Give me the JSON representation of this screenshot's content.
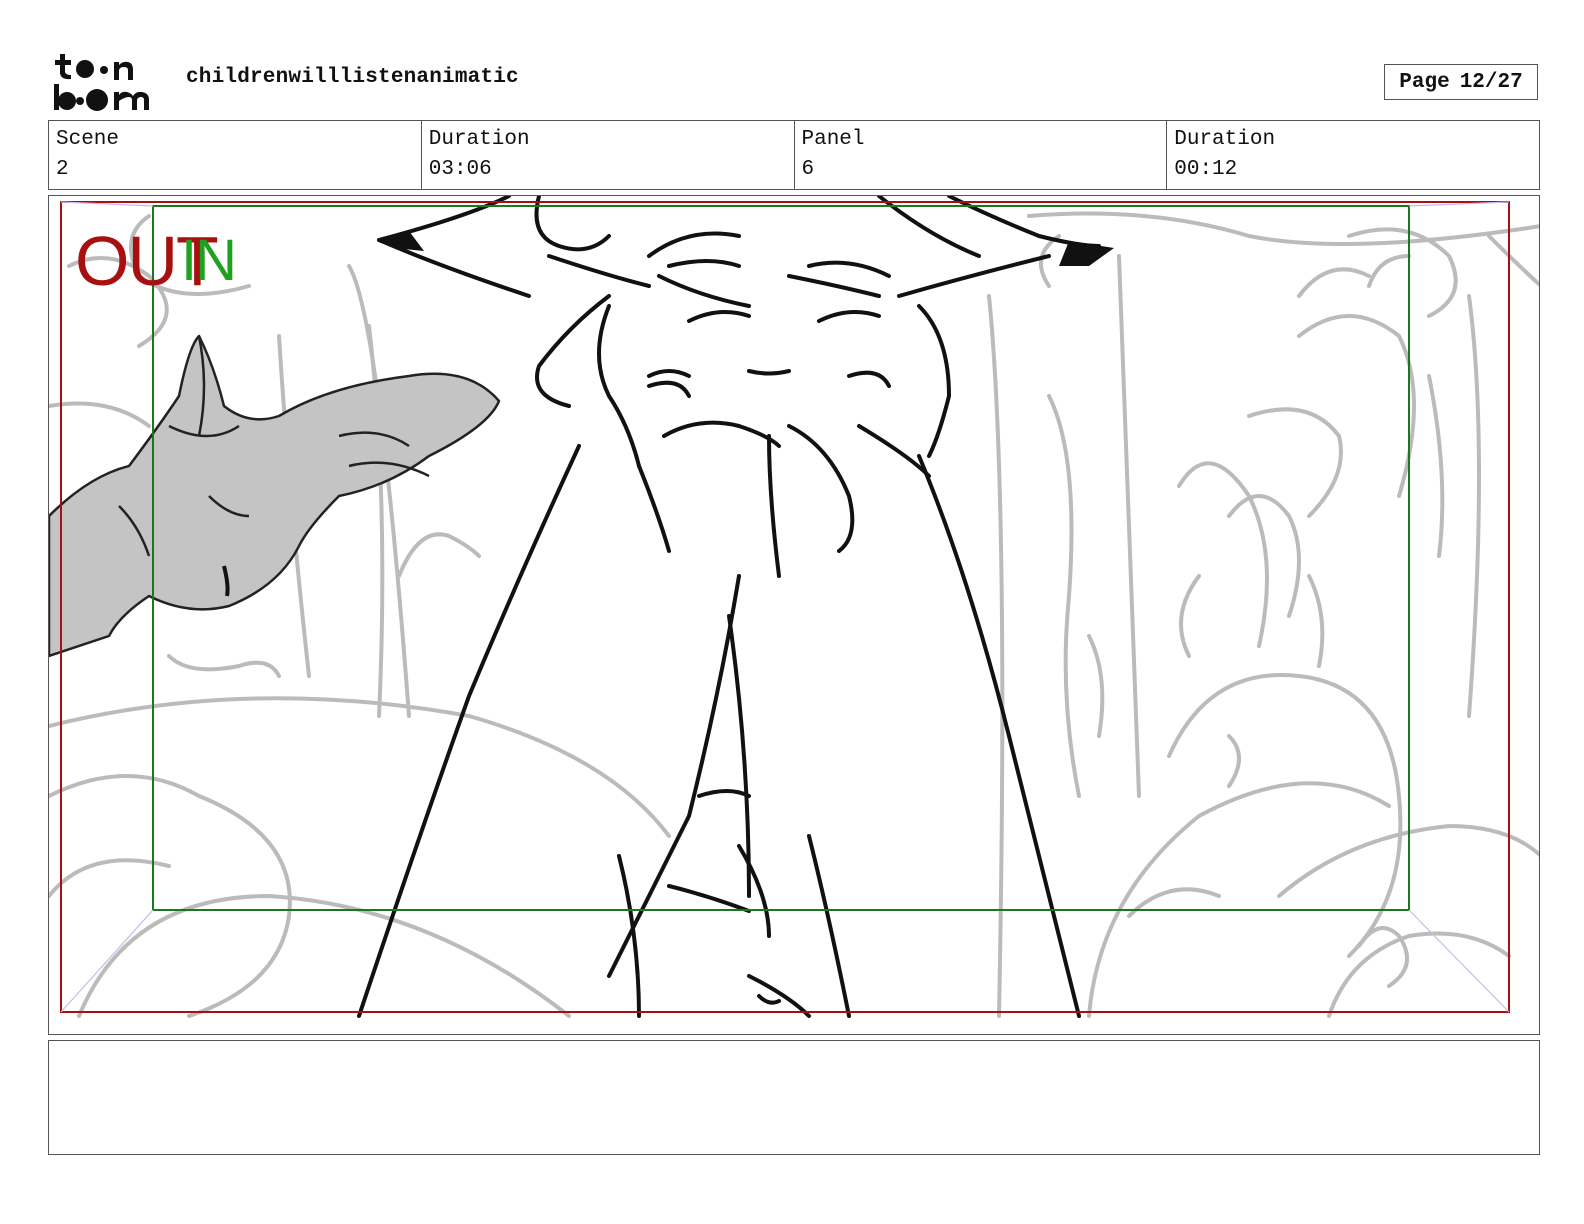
{
  "header": {
    "logo_text": "toon boom",
    "project_title": "childrenwilllistenanimatic",
    "page_label": "Page",
    "page_number": "12/27"
  },
  "info": [
    {
      "label": "Scene",
      "value": "2"
    },
    {
      "label": "Duration",
      "value": "03:06"
    },
    {
      "label": "Panel",
      "value": "6"
    },
    {
      "label": "Duration",
      "value": "00:12"
    }
  ],
  "panel": {
    "out_label": "OUT",
    "in_label": "IN",
    "colors": {
      "out_frame": "#a81010",
      "in_frame": "#1a7a1a",
      "background_lines": "#bbbbbb",
      "character_lines": "#111111",
      "bird_fill": "#c4c4c4"
    }
  },
  "notes": {
    "text": ""
  }
}
